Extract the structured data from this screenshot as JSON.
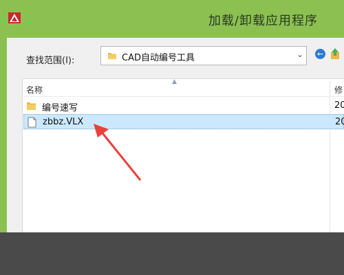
{
  "window": {
    "title": "加载/卸载应用程序"
  },
  "toolbar": {
    "look_in_label": "查找范围(I):",
    "look_in_value": "CAD自动编号工具"
  },
  "filelist": {
    "columns": {
      "name": "名称",
      "modified": "修"
    },
    "rows": [
      {
        "name": "编号速写",
        "type": "folder",
        "date": "20"
      },
      {
        "name": "zbbz.VLX",
        "type": "file",
        "date": "20",
        "selected": true
      }
    ]
  },
  "colors": {
    "titlebar": "#8cc152",
    "selection": "#cce8ff",
    "annotation_arrow": "#e8413b"
  },
  "icons": {
    "app": "autocad-icon",
    "folder": "folder-icon",
    "file": "file-icon",
    "back": "back-icon",
    "up": "up-folder-icon",
    "dropdown": "chevron-down-icon"
  }
}
